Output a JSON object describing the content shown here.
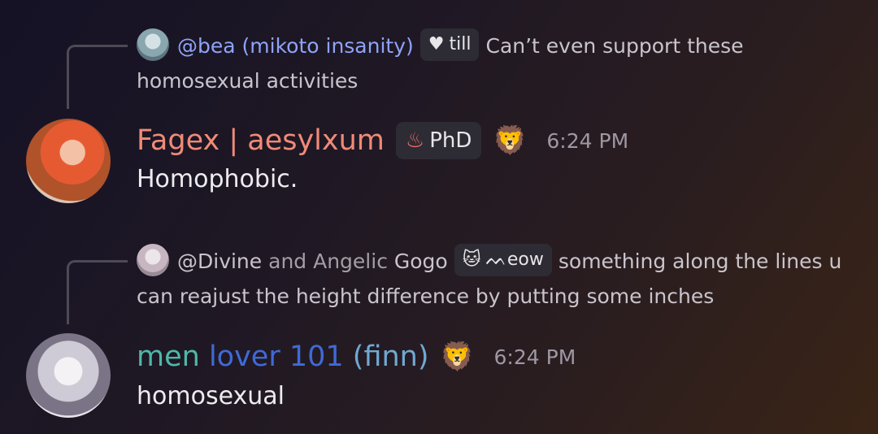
{
  "messages": [
    {
      "reply": {
        "mention": "@bea (mikoto insanity)",
        "tag_icon": "heart-icon",
        "tag_label": "till",
        "text": "Can’t even support these homosexual activities"
      },
      "author": "Fagex | aesylxum",
      "role_badge": "PhD",
      "emoji_icon": "lion-face-icon",
      "time": "6:24 PM",
      "content": "Homophobic."
    },
    {
      "reply": {
        "mention_main": "@Divine",
        "mention_light": " and Angelic",
        "mention_end": " Gogo",
        "tag_icon": "cat-face-icon",
        "tag_label": "ᨓeow",
        "text": "something along the lines   u can reajust the height difference by putting some inches"
      },
      "author_parts": [
        "men",
        "lover 101",
        "(finn)"
      ],
      "emoji_icon": "lion-face-icon",
      "time": "6:24 PM",
      "content": "homosexual"
    }
  ],
  "colors": {
    "mention": "#8fa3f7",
    "author1": "#f08a77",
    "author2_a": "#4fb8a8",
    "author2_b": "#3f6ad6",
    "author2_c": "#6fa9d2",
    "timestamp": "#9d98a2"
  }
}
